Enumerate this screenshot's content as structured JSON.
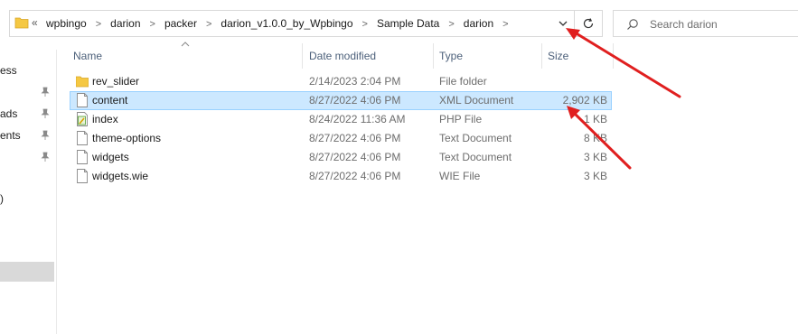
{
  "address_bar": {
    "overflow": "«",
    "breadcrumbs": [
      "wpbingo",
      "darion",
      "packer",
      "darion_v1.0.0_by_Wpbingo",
      "Sample Data",
      "darion"
    ]
  },
  "search": {
    "placeholder": "Search darion"
  },
  "nav": {
    "items": [
      "ess",
      "ads",
      "ents",
      ")"
    ]
  },
  "columns": {
    "name": "Name",
    "date": "Date modified",
    "type": "Type",
    "size": "Size"
  },
  "files": [
    {
      "name": "rev_slider",
      "date": "2/14/2023 2:04 PM",
      "type": "File folder",
      "size": "",
      "icon": "folder-icon"
    },
    {
      "name": "content",
      "date": "8/27/2022 4:06 PM",
      "type": "XML Document",
      "size": "2,902 KB",
      "icon": "document-icon"
    },
    {
      "name": "index",
      "date": "8/24/2022 11:36 AM",
      "type": "PHP File",
      "size": "1 KB",
      "icon": "php-file-icon"
    },
    {
      "name": "theme-options",
      "date": "8/27/2022 4:06 PM",
      "type": "Text Document",
      "size": "8 KB",
      "icon": "document-icon"
    },
    {
      "name": "widgets",
      "date": "8/27/2022 4:06 PM",
      "type": "Text Document",
      "size": "3 KB",
      "icon": "document-icon"
    },
    {
      "name": "widgets.wie",
      "date": "8/27/2022 4:06 PM",
      "type": "WIE File",
      "size": "3 KB",
      "icon": "document-icon"
    }
  ],
  "colors": {
    "selection": "#cce8ff",
    "selection_border": "#99d1ff",
    "annotation_arrow": "#e01f1f",
    "folder": "#f5c843"
  }
}
